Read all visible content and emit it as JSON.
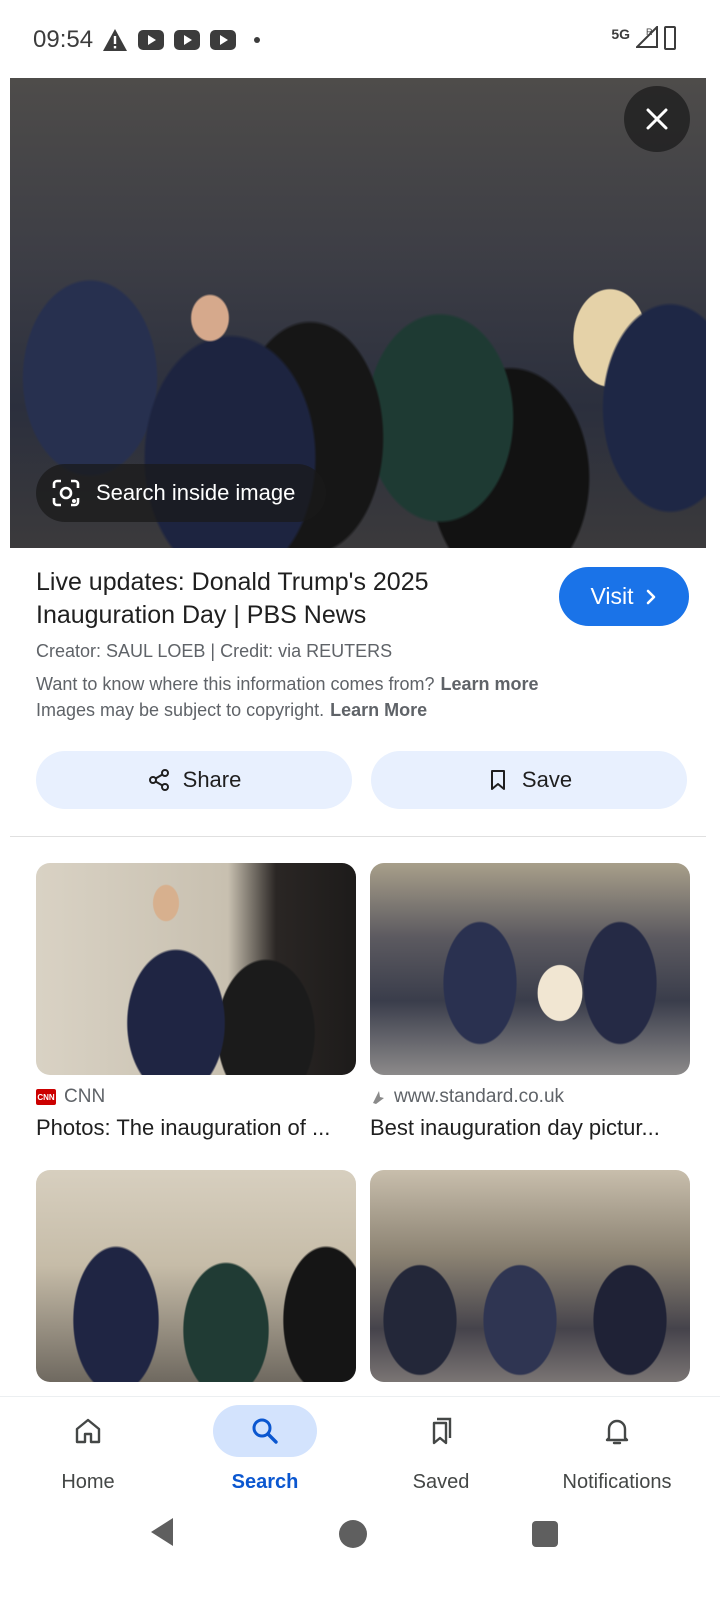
{
  "status_bar": {
    "time": "09:54",
    "network": "5G",
    "roaming": "R",
    "notification_icons": [
      "warning-icon",
      "youtube-icon",
      "youtube-icon",
      "youtube-icon"
    ]
  },
  "hero": {
    "close_icon": "close-icon",
    "lens_chip_label": "Search inside image"
  },
  "result": {
    "title": "Live updates: Donald Trump's 2025 Inauguration Day | PBS News",
    "visit_label": "Visit",
    "creator": "Creator: SAUL LOEB | Credit: via REUTERS",
    "info_text": "Want to know where this information comes from?",
    "info_link": "Learn more",
    "copyright_text": "Images may be subject to copyright.",
    "copyright_link": "Learn More",
    "share_label": "Share",
    "save_label": "Save"
  },
  "related": [
    {
      "source": "CNN",
      "title": "Photos: The inauguration of ..."
    },
    {
      "source": "www.standard.co.uk",
      "title": "Best inauguration day pictur..."
    }
  ],
  "bottom_nav": [
    {
      "label": "Home",
      "icon": "home-icon",
      "active": false
    },
    {
      "label": "Search",
      "icon": "search-icon",
      "active": true
    },
    {
      "label": "Saved",
      "icon": "bookmarks-icon",
      "active": false
    },
    {
      "label": "Notifications",
      "icon": "bell-icon",
      "active": false
    }
  ],
  "colors": {
    "accent": "#1a73e8",
    "active_nav": "#0b57d0",
    "active_nav_pill": "#d3e3fd",
    "chip_bg": "#e8f0fe"
  }
}
